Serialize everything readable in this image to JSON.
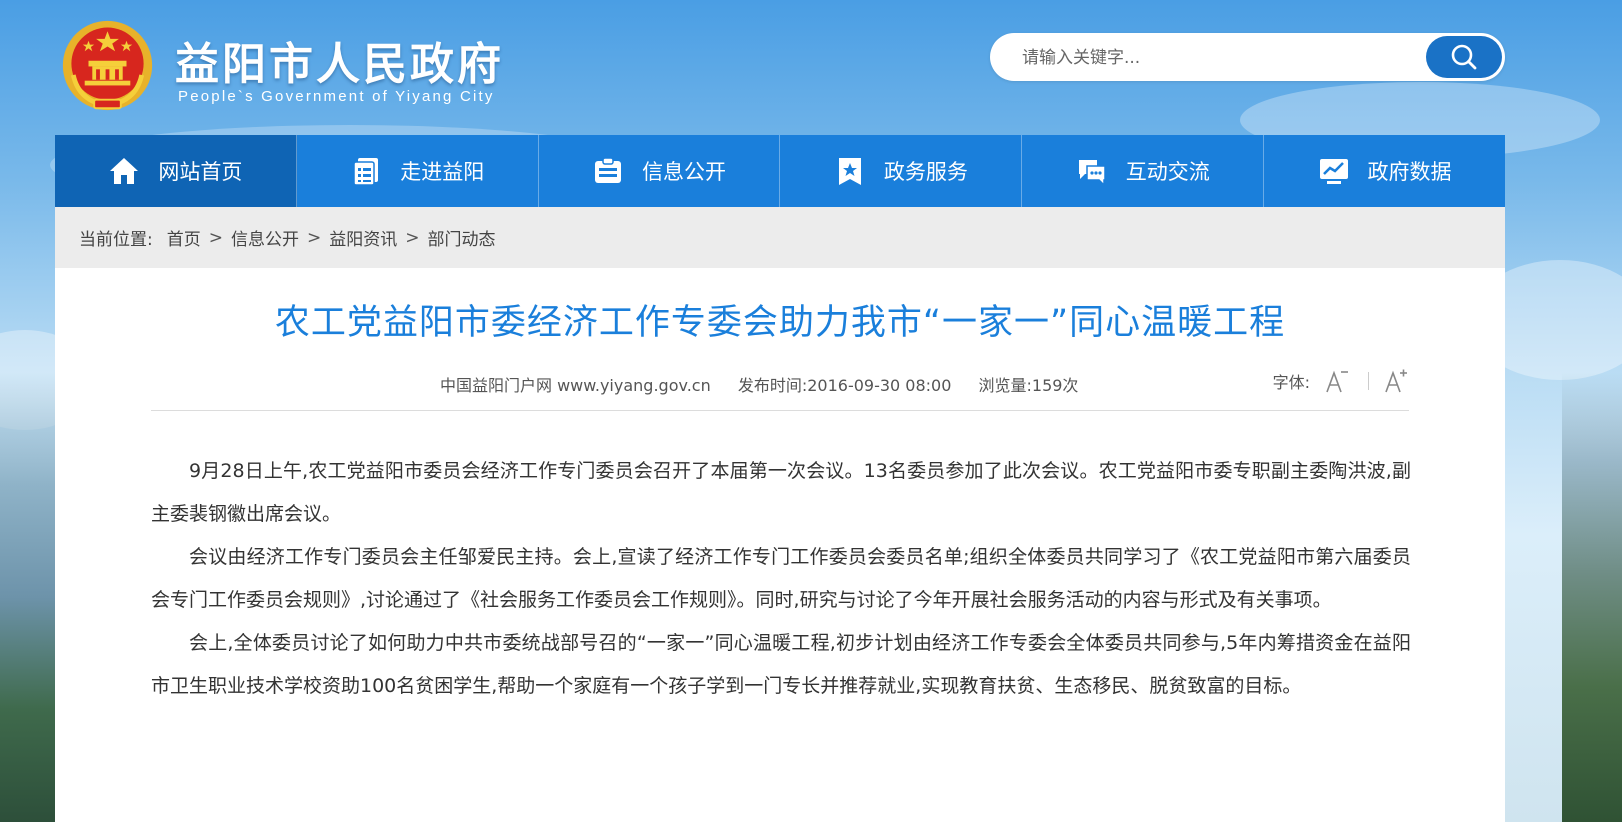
{
  "header": {
    "title": "益阳市人民政府",
    "subtitle": "People`s Government of Yiyang City",
    "emblem_icon": "national-emblem-icon"
  },
  "search": {
    "placeholder": "请输入关键字...",
    "button_icon": "search-icon"
  },
  "nav": {
    "items": [
      {
        "label": "网站首页",
        "icon": "home-icon",
        "active": true
      },
      {
        "label": "走进益阳",
        "icon": "document-list-icon"
      },
      {
        "label": "信息公开",
        "icon": "info-card-icon"
      },
      {
        "label": "政务服务",
        "icon": "bookmark-star-icon"
      },
      {
        "label": "互动交流",
        "icon": "chat-bubbles-icon"
      },
      {
        "label": "政府数据",
        "icon": "chart-monitor-icon"
      }
    ]
  },
  "breadcrumb": {
    "lead": "当前位置:",
    "items": [
      "首页",
      "信息公开",
      "益阳资讯",
      "部门动态"
    ],
    "separator": ">"
  },
  "article": {
    "title": "农工党益阳市委经济工作专委会助力我市“一家一”同心温暖工程",
    "source": "中国益阳门户网 www.yiyang.gov.cn",
    "publish_time": "发布时间:2016-09-30 08:00",
    "views": "浏览量:159次",
    "font_label": "字体:",
    "paragraphs": [
      "9月28日上午,农工党益阳市委员会经济工作专门委员会召开了本届第一次会议。13名委员参加了此次会议。农工党益阳市委专职副主委陶洪波,副主委裴钢徽出席会议。",
      "会议由经济工作专门委员会主任邹爱民主持。会上,宣读了经济工作专门工作委员会委员名单;组织全体委员共同学习了《农工党益阳市第六届委员会专门工作委员会规则》,讨论通过了《社会服务工作委员会工作规则》。同时,研究与讨论了今年开展社会服务活动的内容与形式及有关事项。",
      "会上,全体委员讨论了如何助力中共市委统战部号召的“一家一”同心温暖工程,初步计划由经济工作专委会全体委员共同参与,5年内筹措资金在益阳市卫生职业技术学校资助100名贫困学生,帮助一个家庭有一个孩子学到一门专长并推荐就业,实现教育扶贫、生态移民、脱贫致富的目标。"
    ]
  },
  "colors": {
    "nav_bg": "#1a7fdb",
    "nav_active": "#0f64b4",
    "title_blue": "#1a7fdb",
    "search_button": "#1a72c6"
  }
}
